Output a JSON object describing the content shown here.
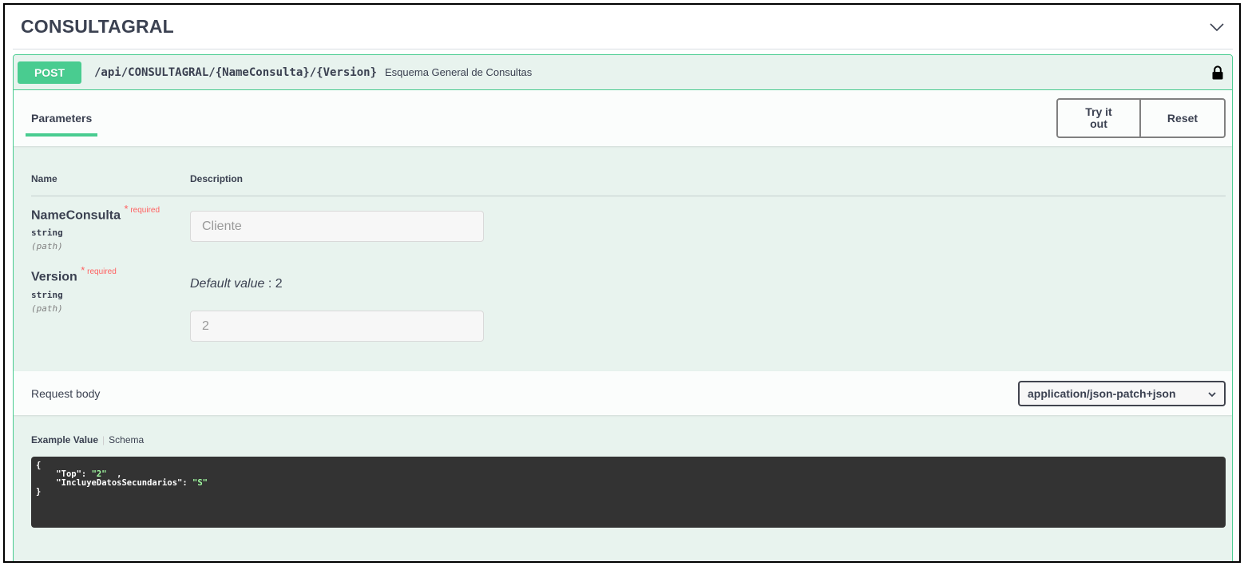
{
  "tag": {
    "title": "CONSULTAGRAL"
  },
  "operation": {
    "method": "POST",
    "path": "/api/CONSULTAGRAL/{NameConsulta}/{Version}",
    "summary": "Esquema General de Consultas"
  },
  "parameters": {
    "tab_label": "Parameters",
    "try_label": "Try it\nout",
    "reset_label": "Reset",
    "col_name": "Name",
    "col_desc": "Description",
    "items": [
      {
        "name": "NameConsulta",
        "required": "required",
        "type": "string",
        "in": "(path)",
        "placeholder": "Cliente",
        "value": ""
      },
      {
        "name": "Version",
        "required": "required",
        "type": "string",
        "in": "(path)",
        "default_label": "Default value",
        "default_value": ": 2",
        "value": "2"
      }
    ]
  },
  "request_body": {
    "title": "Request body",
    "content_type": "application/json-patch+json",
    "tab_example": "Example Value",
    "tab_schema": "Schema",
    "example": {
      "open": "{",
      "l1_key": "\"Top\"",
      "l1_colon": ": ",
      "l1_val": "\"2\"",
      "l1_tail": "  ,",
      "l2_key": "\"IncluyeDatosSecundarios\"",
      "l2_colon": ": ",
      "l2_val": "\"S\"",
      "close": "}"
    }
  },
  "colors": {
    "post": "#49cc90",
    "post_bg": "#e8f3ee",
    "required": "#ff6060",
    "code_bg": "#333333",
    "code_string": "#a2fca2"
  }
}
